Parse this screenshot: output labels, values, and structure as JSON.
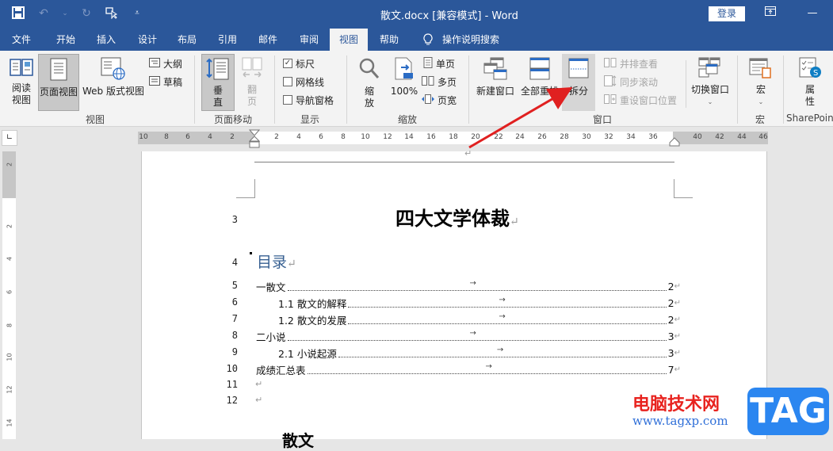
{
  "window": {
    "title": "散文.docx [兼容模式]  -  Word",
    "login_label": "登录",
    "ribbon_display_icon": "ribbon-display-icon",
    "minimize_icon": "minimize-icon"
  },
  "quick_access": [
    {
      "name": "save-icon",
      "glyph": "💾"
    },
    {
      "name": "undo-icon",
      "glyph": "↶"
    },
    {
      "name": "redo-icon",
      "glyph": "↻"
    },
    {
      "name": "touch-mode-icon",
      "glyph": "⬚"
    },
    {
      "name": "customize-qat-icon",
      "glyph": "▾"
    }
  ],
  "tabs": [
    {
      "label": "文件"
    },
    {
      "label": "开始"
    },
    {
      "label": "插入"
    },
    {
      "label": "设计"
    },
    {
      "label": "布局"
    },
    {
      "label": "引用"
    },
    {
      "label": "邮件"
    },
    {
      "label": "审阅"
    },
    {
      "label": "视图",
      "active": true
    },
    {
      "label": "帮助"
    },
    {
      "label": "操作说明搜索"
    }
  ],
  "ribbon": {
    "views": {
      "group": "视图",
      "read_mode": "阅读\n视图",
      "read_mode_l1": "阅读",
      "read_mode_l2": "视图",
      "print_layout": "页面视图",
      "web_layout": "Web 版式视图",
      "outline": "大纲",
      "draft": "草稿"
    },
    "page_movement": {
      "group": "页面移动",
      "vertical_l1": "垂",
      "vertical_l2": "直",
      "side_l1": "翻",
      "side_l2": "页"
    },
    "show": {
      "group": "显示",
      "ruler": "标尺",
      "ruler_checked": true,
      "gridlines": "网格线",
      "gridlines_checked": false,
      "nav_pane": "导航窗格",
      "nav_pane_checked": false
    },
    "zoom": {
      "group": "缩放",
      "zoom_l1": "缩",
      "zoom_l2": "放",
      "hundred": "100%",
      "one_page": "单页",
      "multi_page": "多页",
      "page_width": "页宽"
    },
    "window": {
      "group": "窗口",
      "new_window": "新建窗口",
      "arrange_all": "全部重排",
      "split": "拆分",
      "side_by_side": "并排查看",
      "sync_scroll": "同步滚动",
      "reset_position": "重设窗口位置",
      "switch_windows": "切换窗口"
    },
    "macros": {
      "group": "宏",
      "macros": "宏"
    },
    "sharepoint": {
      "group": "SharePoint",
      "properties_l1": "属",
      "properties_l2": "性"
    }
  },
  "ruler": {
    "horizontal_ticks": [
      "10",
      "8",
      "6",
      "4",
      "2",
      "2",
      "4",
      "6",
      "8",
      "10",
      "12",
      "14",
      "16",
      "18",
      "20",
      "22",
      "24",
      "26",
      "28",
      "30",
      "32",
      "34",
      "36",
      "40",
      "42",
      "44",
      "46"
    ],
    "vertical_ticks": [
      "2",
      "2",
      "4",
      "6",
      "8",
      "10",
      "12",
      "14"
    ],
    "corner_glyph": "∟"
  },
  "document": {
    "title": "四大文学体裁",
    "toc_heading": "目录",
    "para_mark": "↵",
    "tab_mark": "→",
    "line_numbers": [
      "3",
      "4",
      "5",
      "6",
      "7",
      "8",
      "9",
      "10",
      "11",
      "12"
    ],
    "toc": [
      {
        "label": "一散文",
        "page": "2",
        "level": 1
      },
      {
        "label": "1.1 散文的解释",
        "page": "2",
        "level": 2
      },
      {
        "label": "1.2 散文的发展",
        "page": "2",
        "level": 2
      },
      {
        "label": "二小说",
        "page": "3",
        "level": 1
      },
      {
        "label": "2.1 小说起源",
        "page": "3",
        "level": 2
      },
      {
        "label": "成绩汇总表",
        "page": "7",
        "level": 1
      }
    ],
    "next_heading_partial": "散文"
  },
  "watermark": {
    "site_name": "电脑技术网",
    "url": "www.tagxp.com",
    "badge": "TAG"
  },
  "annotation": {
    "arrow_color": "#e02020",
    "target": "拆分"
  }
}
